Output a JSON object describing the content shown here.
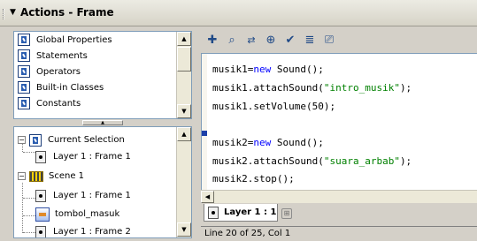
{
  "window": {
    "title": "Actions - Frame"
  },
  "toolbox": {
    "items": [
      {
        "label": "Global Properties",
        "icon": "book-icon"
      },
      {
        "label": "Statements",
        "icon": "book-icon"
      },
      {
        "label": "Operators",
        "icon": "book-icon"
      },
      {
        "label": "Built-in Classes",
        "icon": "book-icon"
      },
      {
        "label": "Constants",
        "icon": "book-icon"
      }
    ]
  },
  "navigator": {
    "current_selection": "Current Selection",
    "current_frame": "Layer 1 : Frame 1",
    "scene": "Scene 1",
    "scene_frame_1": "Layer 1 : Frame 1",
    "button_symbol": "tombol_masuk",
    "scene_frame_2": "Layer 1 : Frame 2"
  },
  "toolbar": {
    "icons": [
      "add-action-icon",
      "find-icon",
      "replace-icon",
      "insert-target-path-icon",
      "check-syntax-icon",
      "auto-format-icon",
      "code-hint-icon"
    ]
  },
  "editor": {
    "lines": [
      {
        "var": "musik1",
        "op": "=",
        "kw": "new",
        "rest": " Sound();"
      },
      {
        "prefix": "musik1.attachSound(",
        "str": "\"intro_musik\"",
        "suffix": ");"
      },
      {
        "prefix": "musik1.setVolume(50);"
      },
      {
        "prefix": ""
      },
      {
        "var": "musik2",
        "op": "=",
        "kw": "new",
        "rest": " Sound();"
      },
      {
        "prefix": "musik2.attachSound(",
        "str": "\"suara_arbab\"",
        "suffix": ");"
      },
      {
        "prefix": "musik2.stop();"
      }
    ]
  },
  "tab": {
    "label": "Layer 1 : 1"
  },
  "status": {
    "text": "Line 20 of 25, Col 1"
  }
}
